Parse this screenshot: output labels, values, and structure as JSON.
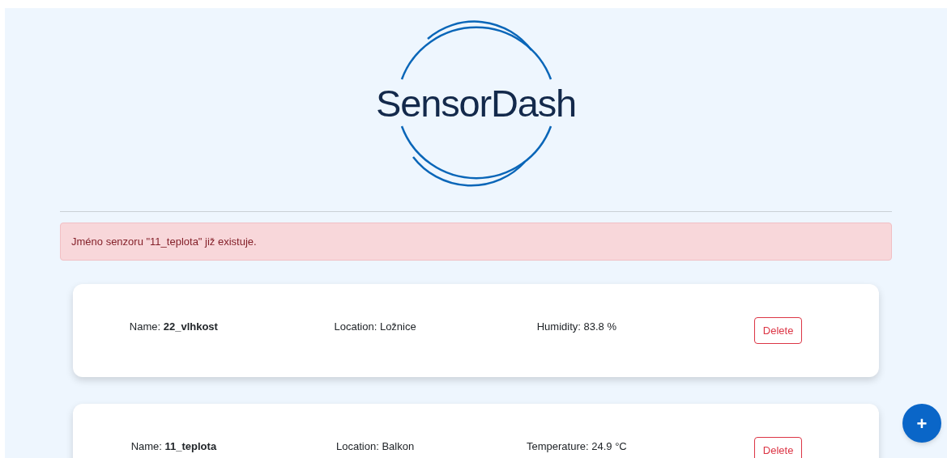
{
  "logo": {
    "text": "SensorDash"
  },
  "alert": {
    "message": "Jméno senzoru \"11_teplota\" již existuje."
  },
  "sensors": [
    {
      "name": "Name: **22_vlhkost**",
      "location": "Location: Ložnice",
      "reading": "Humidity: 83.8 %",
      "action": "Delete"
    },
    {
      "name": "Name: **11_teplota**",
      "location": "Location: Balkon",
      "reading": "Temperature: 24.9 °C",
      "action": "Delete"
    }
  ],
  "add_button": {
    "label": "+"
  }
}
